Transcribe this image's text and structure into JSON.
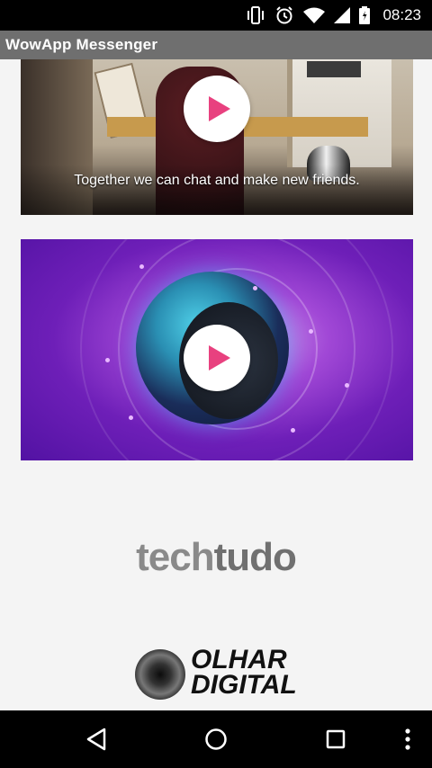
{
  "status_bar": {
    "time": "08:23",
    "icons": [
      "vibrate-icon",
      "alarm-icon",
      "wifi-icon",
      "signal-icon",
      "battery-icon"
    ]
  },
  "app_bar": {
    "title": "WowApp Messenger"
  },
  "videos": [
    {
      "subtitle": "Together we can chat and make new friends.",
      "play_icon": "play-icon"
    },
    {
      "subtitle": "",
      "play_icon": "play-icon"
    }
  ],
  "logos": {
    "techtudo": {
      "part1": "tech",
      "part2": "tudo"
    },
    "olhar_digital": {
      "line1": "OLHAR",
      "line2": "DIGITAL"
    }
  },
  "nav_bar": {
    "icons": [
      "back-icon",
      "home-icon",
      "recents-icon",
      "overflow-menu-icon"
    ]
  },
  "colors": {
    "accent_play": "#e8417f",
    "app_bar": "#6f6f6f",
    "background": "#f4f4f4"
  }
}
